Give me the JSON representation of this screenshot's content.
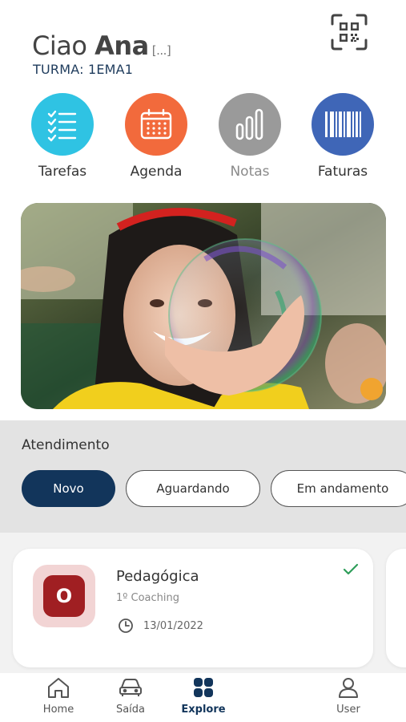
{
  "header": {
    "greeting": "Ciao",
    "name": "Ana",
    "more": "[...]",
    "turma": "TURMA: 1EMA1"
  },
  "shortcuts": [
    {
      "label": "Tarefas",
      "icon": "checklist-icon",
      "color": "#2fc3e3"
    },
    {
      "label": "Agenda",
      "icon": "calendar-icon",
      "color": "#f26a3c"
    },
    {
      "label": "Notas",
      "icon": "bar-chart-icon",
      "color": "#9a9a9a"
    },
    {
      "label": "Faturas",
      "icon": "barcode-icon",
      "color": "#3f66b7"
    }
  ],
  "atendimento": {
    "title": "Atendimento",
    "filters": [
      "Novo",
      "Aguardando",
      "Em andamento"
    ],
    "selected": "Novo"
  },
  "card": {
    "avatar_letter": "O",
    "title": "Pedagógica",
    "subtitle": "1º Coaching",
    "date": "13/01/2022",
    "status_icon": "check-icon"
  },
  "nav": [
    {
      "label": "Home",
      "icon": "home-icon"
    },
    {
      "label": "Saída",
      "icon": "car-icon"
    },
    {
      "label": "Explore",
      "icon": "grid-icon"
    },
    {
      "label": "User",
      "icon": "user-icon"
    }
  ],
  "colors": {
    "primary": "#12355b",
    "accent_red": "#a01f22",
    "check_green": "#2e9e5a"
  }
}
